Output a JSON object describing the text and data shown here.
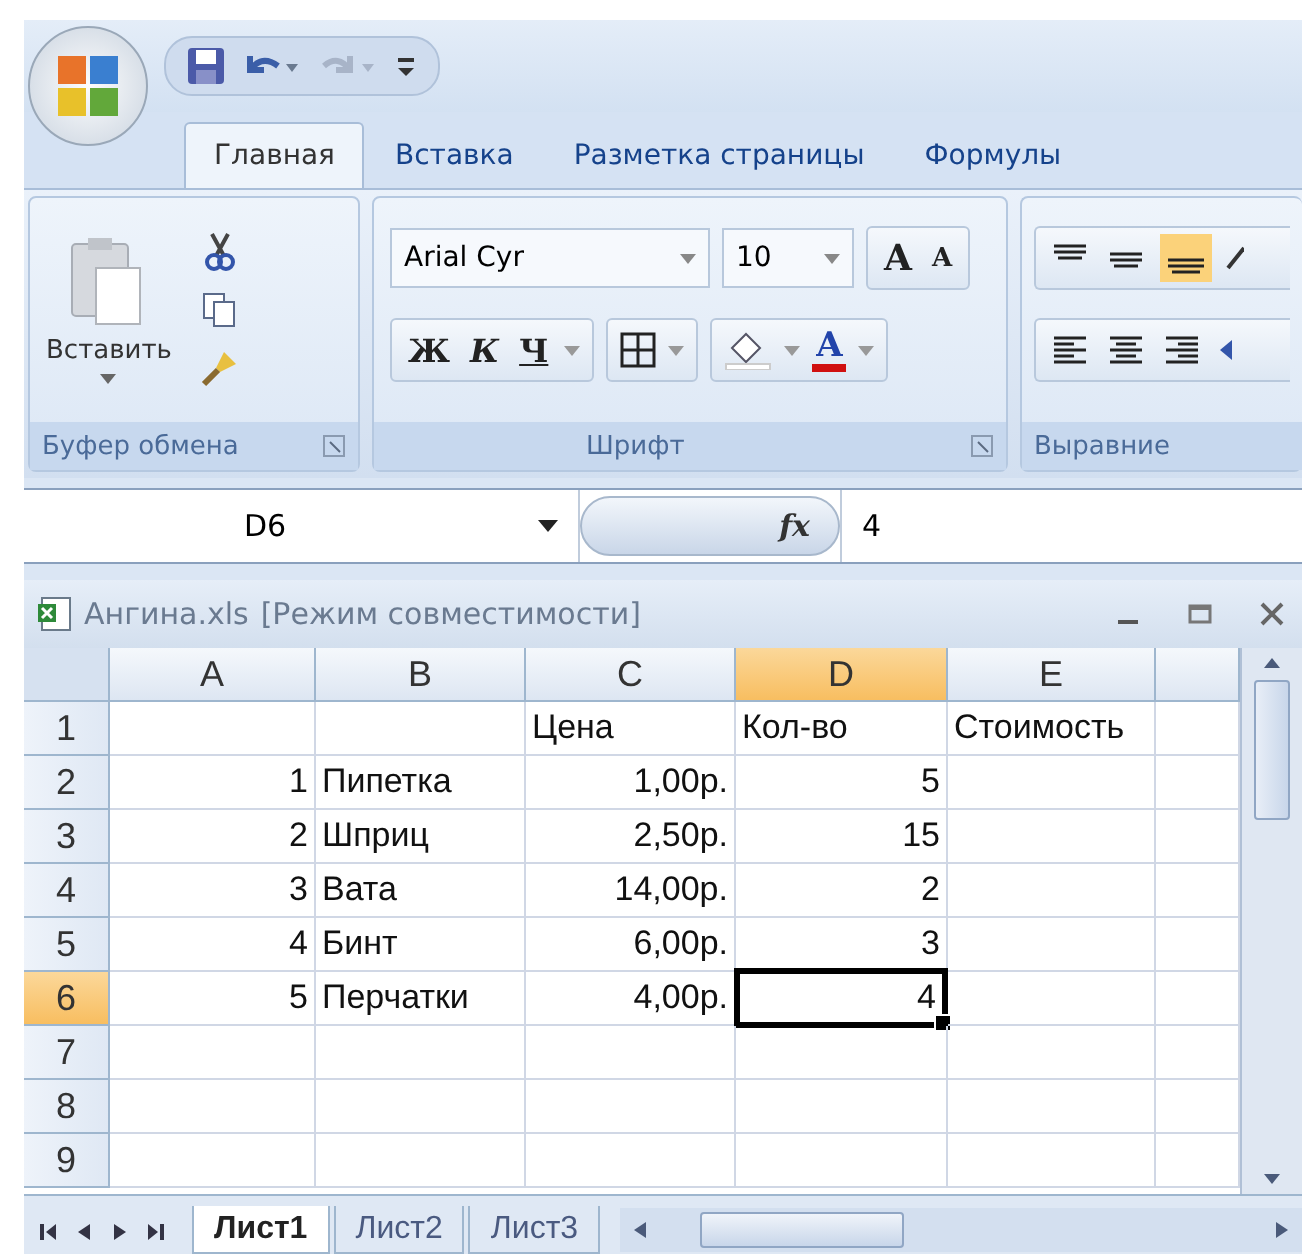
{
  "tabs": [
    {
      "label": "Главная",
      "selected": true
    },
    {
      "label": "Вставка",
      "selected": false
    },
    {
      "label": "Разметка страницы",
      "selected": false
    },
    {
      "label": "Формулы",
      "selected": false
    }
  ],
  "ribbon": {
    "clipboard": {
      "label": "Буфер обмена",
      "paste": "Вставить"
    },
    "font": {
      "label": "Шрифт",
      "font_name": "Arial Cyr",
      "font_size": "10",
      "grow": "A",
      "shrink": "A",
      "bold": "Ж",
      "italic": "К",
      "underline": "Ч",
      "font_color": "A"
    },
    "alignment": {
      "label": "Выравние"
    }
  },
  "formula_bar": {
    "name_box": "D6",
    "fx": "fx",
    "value": "4"
  },
  "workbook": {
    "title": "Ангина.xls",
    "mode": "[Режим совместимости]"
  },
  "sheet": {
    "columns": [
      {
        "label": "A",
        "selected": false
      },
      {
        "label": "B",
        "selected": false
      },
      {
        "label": "C",
        "selected": false
      },
      {
        "label": "D",
        "selected": true
      },
      {
        "label": "E",
        "selected": false
      }
    ],
    "rows": [
      {
        "label": "1",
        "selected": false,
        "cells": [
          null,
          null,
          {
            "text": "Цена",
            "kind": "text"
          },
          {
            "text": "Кол-во",
            "kind": "text"
          },
          {
            "text": "Стоимость",
            "kind": "text"
          }
        ]
      },
      {
        "label": "2",
        "selected": false,
        "cells": [
          {
            "text": "1",
            "kind": "number"
          },
          {
            "text": "Пипетка",
            "kind": "text"
          },
          {
            "text": "1,00р.",
            "kind": "number"
          },
          {
            "text": "5",
            "kind": "number"
          },
          null
        ]
      },
      {
        "label": "3",
        "selected": false,
        "cells": [
          {
            "text": "2",
            "kind": "number"
          },
          {
            "text": "Шприц",
            "kind": "text"
          },
          {
            "text": "2,50р.",
            "kind": "number"
          },
          {
            "text": "15",
            "kind": "number"
          },
          null
        ]
      },
      {
        "label": "4",
        "selected": false,
        "cells": [
          {
            "text": "3",
            "kind": "number"
          },
          {
            "text": "Вата",
            "kind": "text"
          },
          {
            "text": "14,00р.",
            "kind": "number"
          },
          {
            "text": "2",
            "kind": "number"
          },
          null
        ]
      },
      {
        "label": "5",
        "selected": false,
        "cells": [
          {
            "text": "4",
            "kind": "number"
          },
          {
            "text": "Бинт",
            "kind": "text"
          },
          {
            "text": "6,00р.",
            "kind": "number"
          },
          {
            "text": "3",
            "kind": "number"
          },
          null
        ]
      },
      {
        "label": "6",
        "selected": true,
        "cells": [
          {
            "text": "5",
            "kind": "number"
          },
          {
            "text": "Перчатки",
            "kind": "text"
          },
          {
            "text": "4,00р.",
            "kind": "number"
          },
          {
            "text": "4",
            "kind": "number"
          },
          null
        ]
      },
      {
        "label": "7",
        "selected": false,
        "cells": [
          null,
          null,
          null,
          null,
          null
        ]
      },
      {
        "label": "8",
        "selected": false,
        "cells": [
          null,
          null,
          null,
          null,
          null
        ]
      },
      {
        "label": "9",
        "selected": false,
        "cells": [
          null,
          null,
          null,
          null,
          null
        ]
      }
    ]
  },
  "sheet_tabs": [
    {
      "label": "Лист1",
      "selected": true
    },
    {
      "label": "Лист2",
      "selected": false
    },
    {
      "label": "Лист3",
      "selected": false
    }
  ]
}
